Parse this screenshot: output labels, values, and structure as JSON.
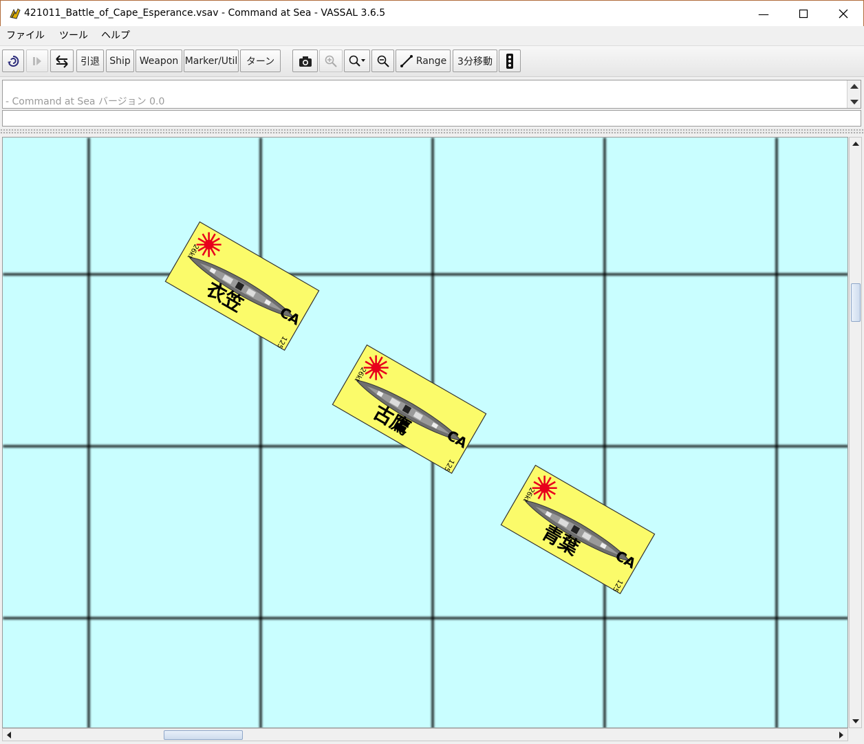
{
  "window": {
    "title": "421011_Battle_of_Cape_Esperance.vsav - Command at Sea - VASSAL 3.6.5",
    "minimize_glyph": "—",
    "maximize_glyph": "☐",
    "close_glyph": "✕",
    "app_icon": "vassal-logo-icon"
  },
  "menu": {
    "items": [
      "ファイル",
      "ツール",
      "ヘルプ"
    ]
  },
  "toolbar": {
    "undo_icon": "undo-icon",
    "step_icon": "step-forward-icon",
    "flip_icon": "swap-arrows-icon",
    "retreat_label": "引退",
    "ship_label": "Ship",
    "weapon_label": "Weapon",
    "marker_label": "Marker/Util",
    "turn_label": "ターン",
    "camera_icon": "camera-icon",
    "zoom_in_icon": "zoom-in-icon",
    "zoom_menu_icon": "zoom-dropdown-icon",
    "zoom_out_icon": "zoom-out-icon",
    "range_label": "Range",
    "move_label": "3分移動",
    "traffic_icon": "signal-icon"
  },
  "chat": {
    "log_text": "- Command at Sea バージョン 0.0",
    "input_value": ""
  },
  "map": {
    "water_color": "#c9feff",
    "grid_color": "#000000",
    "counter_color": "#fbfb6a",
    "counters": [
      {
        "name": "衣笠",
        "type": "CA",
        "speed": "26kt",
        "value": "125"
      },
      {
        "name": "古鷹",
        "type": "CA",
        "speed": "26kt",
        "value": "125"
      },
      {
        "name": "青葉",
        "type": "CA",
        "speed": "26kt",
        "value": "125"
      }
    ]
  }
}
